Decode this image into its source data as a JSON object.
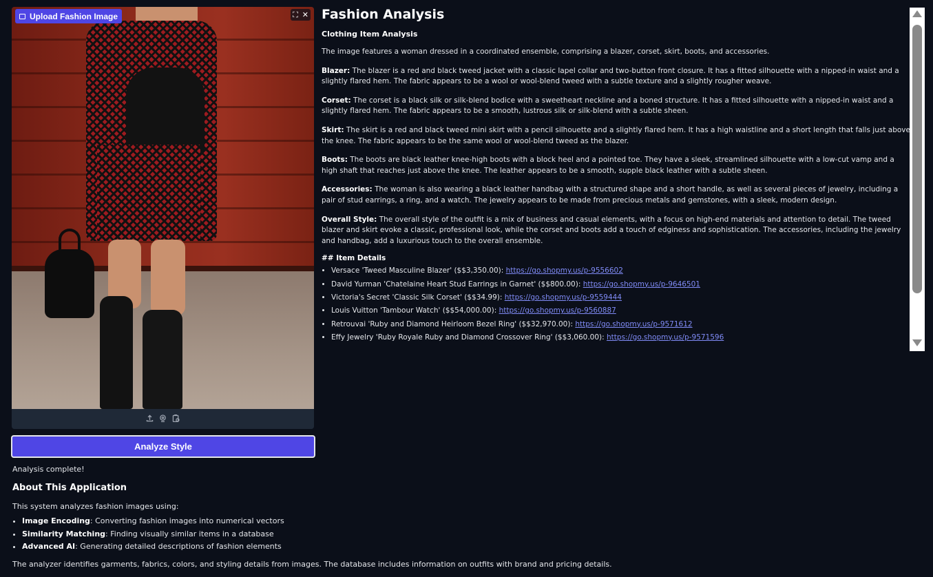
{
  "upload": {
    "label": "Upload Fashion Image",
    "corner_icons": [
      "fullscreen-icon",
      "close-icon"
    ],
    "toolbar_icons": [
      "upload-icon",
      "webcam-icon",
      "clipboard-icon"
    ]
  },
  "analyze_button": {
    "label": "Analyze Style"
  },
  "status": {
    "text": "Analysis complete!"
  },
  "about": {
    "title": "About This Application",
    "intro": "This system analyzes fashion images using:",
    "items": [
      {
        "term": "Image Encoding",
        "desc": ": Converting fashion images into numerical vectors"
      },
      {
        "term": "Similarity Matching",
        "desc": ": Finding visually similar items in a database"
      },
      {
        "term": "Advanced AI",
        "desc": ": Generating detailed descriptions of fashion elements"
      }
    ],
    "footer": "The analyzer identifies garments, fabrics, colors, and styling details from images. The database includes information on outfits with brand and pricing details."
  },
  "analysis": {
    "title": "Fashion Analysis",
    "subtitle": "Clothing Item Analysis",
    "intro": "The image features a woman dressed in a coordinated ensemble, comprising a blazer, corset, skirt, boots, and accessories.",
    "sections": [
      {
        "term": "Blazer:",
        "text": " The blazer is a red and black tweed jacket with a classic lapel collar and two-button front closure. It has a fitted silhouette with a nipped-in waist and a slightly flared hem. The fabric appears to be a wool or wool-blend tweed with a subtle texture and a slightly rougher weave."
      },
      {
        "term": "Corset:",
        "text": " The corset is a black silk or silk-blend bodice with a sweetheart neckline and a boned structure. It has a fitted silhouette with a nipped-in waist and a slightly flared hem. The fabric appears to be a smooth, lustrous silk or silk-blend with a subtle sheen."
      },
      {
        "term": "Skirt:",
        "text": " The skirt is a red and black tweed mini skirt with a pencil silhouette and a slightly flared hem. It has a high waistline and a short length that falls just above the knee. The fabric appears to be the same wool or wool-blend tweed as the blazer."
      },
      {
        "term": "Boots:",
        "text": " The boots are black leather knee-high boots with a block heel and a pointed toe. They have a sleek, streamlined silhouette with a low-cut vamp and a high shaft that reaches just above the knee. The leather appears to be a smooth, supple black leather with a subtle sheen."
      },
      {
        "term": "Accessories:",
        "text": " The woman is also wearing a black leather handbag with a structured shape and a short handle, as well as several pieces of jewelry, including a pair of stud earrings, a ring, and a watch. The jewelry appears to be made from precious metals and gemstones, with a sleek, modern design."
      },
      {
        "term": "Overall Style:",
        "text": " The overall style of the outfit is a mix of business and casual elements, with a focus on high-end materials and attention to detail. The tweed blazer and skirt evoke a classic, professional look, while the corset and boots add a touch of edginess and sophistication. The accessories, including the jewelry and handbag, add a luxurious touch to the overall ensemble."
      }
    ],
    "details_heading": "## Item Details",
    "items": [
      {
        "text": "Versace 'Tweed Masculine Blazer' ($$3,350.00): ",
        "link": "https://go.shopmy.us/p-9556602"
      },
      {
        "text": "David Yurman 'Chatelaine Heart Stud Earrings in Garnet' ($$800.00): ",
        "link": "https://go.shopmy.us/p-9646501"
      },
      {
        "text": "Victoria's Secret 'Classic Silk Corset' ($$34.99): ",
        "link": "https://go.shopmy.us/p-9559444"
      },
      {
        "text": "Louis Vuitton 'Tambour Watch' ($$54,000.00): ",
        "link": "https://go.shopmy.us/p-9560887"
      },
      {
        "text": "Retrouvai 'Ruby and Diamond Heirloom Bezel Ring' ($$32,970.00): ",
        "link": "https://go.shopmy.us/p-9571612"
      },
      {
        "text": "Effy Jewelry 'Ruby Royale Ruby and Diamond Crossover Ring' ($$3,060.00): ",
        "link": "https://go.shopmy.us/p-9571596"
      }
    ]
  },
  "colors": {
    "background": "#0b0f19",
    "accent": "#4f46e5",
    "link": "#818cf8"
  }
}
